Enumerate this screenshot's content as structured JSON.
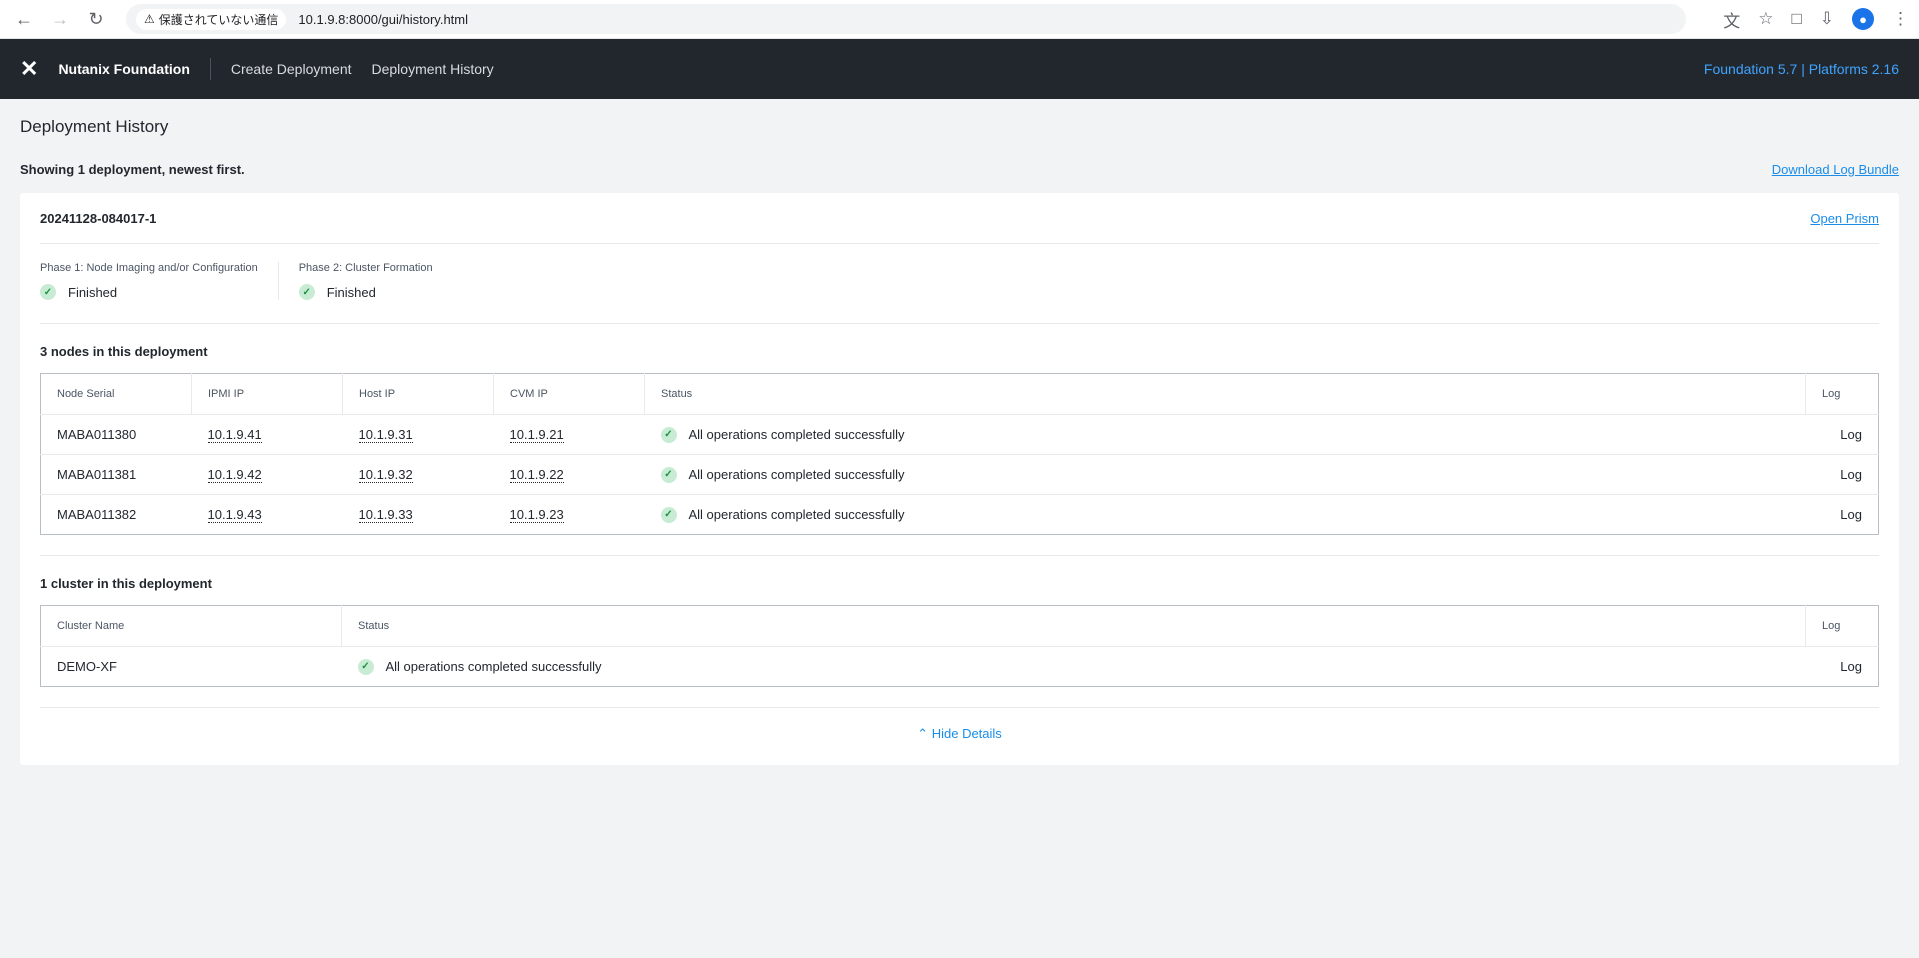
{
  "browser": {
    "security_label": "保護されていない通信",
    "url": "10.1.9.8:8000/gui/history.html"
  },
  "app": {
    "brand": "Nutanix Foundation",
    "nav": [
      "Create Deployment",
      "Deployment History"
    ],
    "version": "Foundation 5.7 | Platforms 2.16"
  },
  "page": {
    "title": "Deployment History",
    "summary": "Showing 1 deployment, newest first.",
    "download_label": "Download Log Bundle"
  },
  "deployment": {
    "id": "20241128-084017-1",
    "open_prism": "Open Prism",
    "phases": [
      {
        "label": "Phase 1: Node Imaging and/or Configuration",
        "status": "Finished"
      },
      {
        "label": "Phase 2: Cluster Formation",
        "status": "Finished"
      }
    ],
    "nodes_title": "3 nodes in this deployment",
    "node_columns": [
      "Node Serial",
      "IPMI IP",
      "Host IP",
      "CVM IP",
      "Status",
      "Log"
    ],
    "nodes": [
      {
        "serial": "MABA011380",
        "ipmi": "10.1.9.41",
        "host": "10.1.9.31",
        "cvm": "10.1.9.21",
        "status": "All operations completed successfully",
        "log": "Log"
      },
      {
        "serial": "MABA011381",
        "ipmi": "10.1.9.42",
        "host": "10.1.9.32",
        "cvm": "10.1.9.22",
        "status": "All operations completed successfully",
        "log": "Log"
      },
      {
        "serial": "MABA011382",
        "ipmi": "10.1.9.43",
        "host": "10.1.9.33",
        "cvm": "10.1.9.23",
        "status": "All operations completed successfully",
        "log": "Log"
      }
    ],
    "clusters_title": "1 cluster in this deployment",
    "cluster_columns": [
      "Cluster Name",
      "Status",
      "Log"
    ],
    "clusters": [
      {
        "name": "DEMO-XF",
        "status": "All operations completed successfully",
        "log": "Log"
      }
    ],
    "hide_details": "Hide Details"
  },
  "colors": {
    "header_bg": "#22272e",
    "accent": "#1b8de8",
    "success": "#1f8f45"
  }
}
